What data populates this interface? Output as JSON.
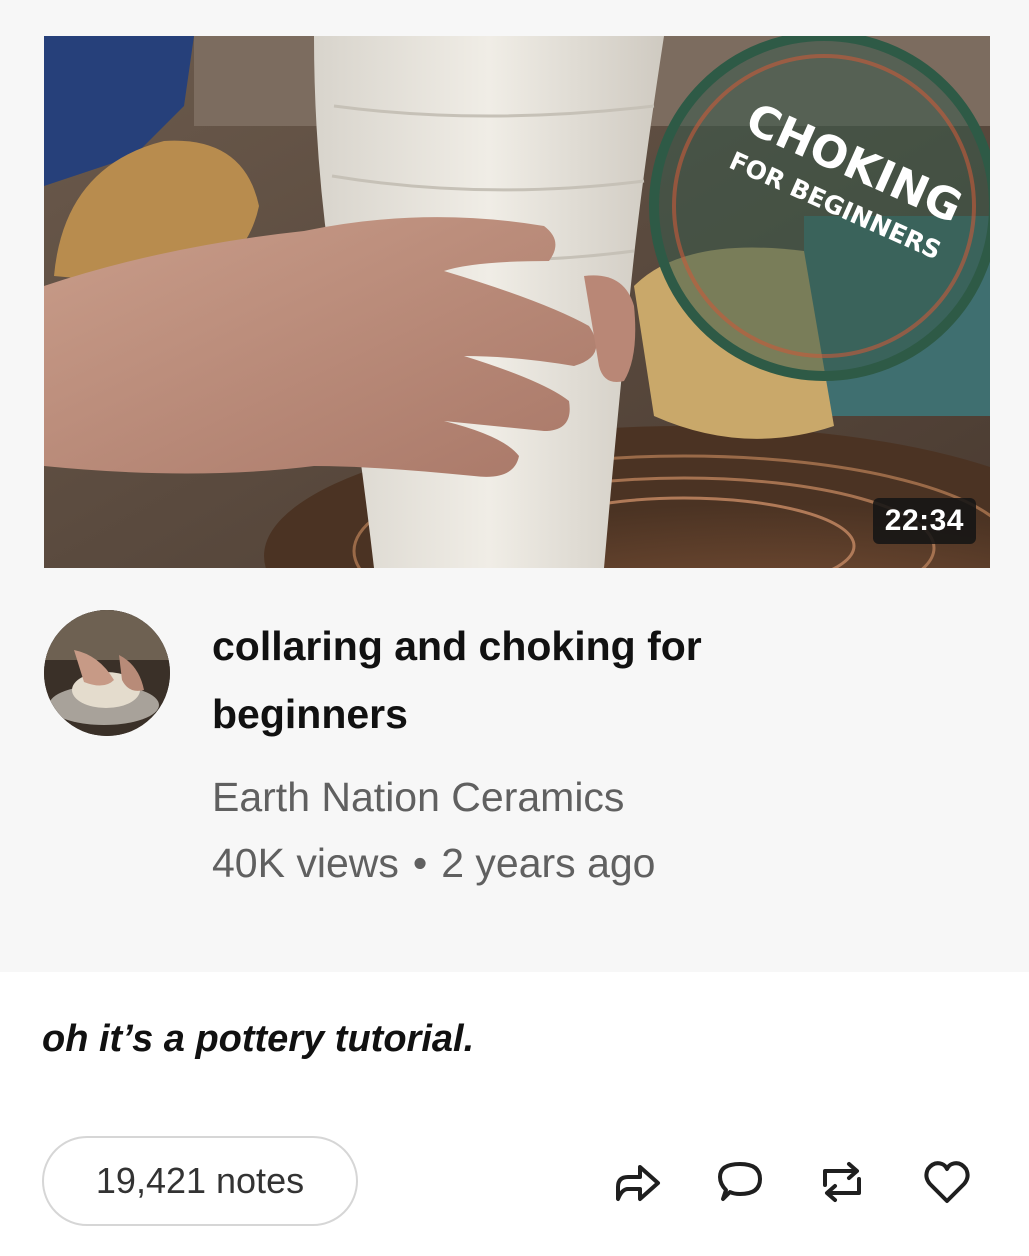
{
  "video": {
    "thumbnail_overlay_title": "CHOKING",
    "thumbnail_overlay_subtitle": "FOR BEGINNERS",
    "duration": "22:34",
    "title": "collaring and choking for beginners",
    "channel": "Earth Nation Ceramics",
    "views": "40K views",
    "separator": "•",
    "age": "2 years ago"
  },
  "post": {
    "caption": "oh it’s a pottery tutorial.",
    "notes_label": "19,421 notes"
  },
  "actions": [
    {
      "name": "share-icon"
    },
    {
      "name": "reply-icon"
    },
    {
      "name": "reblog-icon"
    },
    {
      "name": "like-icon"
    }
  ],
  "colors": {
    "card_background": "#f7f7f7",
    "title_text": "#111111",
    "meta_text": "#606060",
    "overlay_ring": "#2e5a46",
    "badge_background": "#141414"
  }
}
